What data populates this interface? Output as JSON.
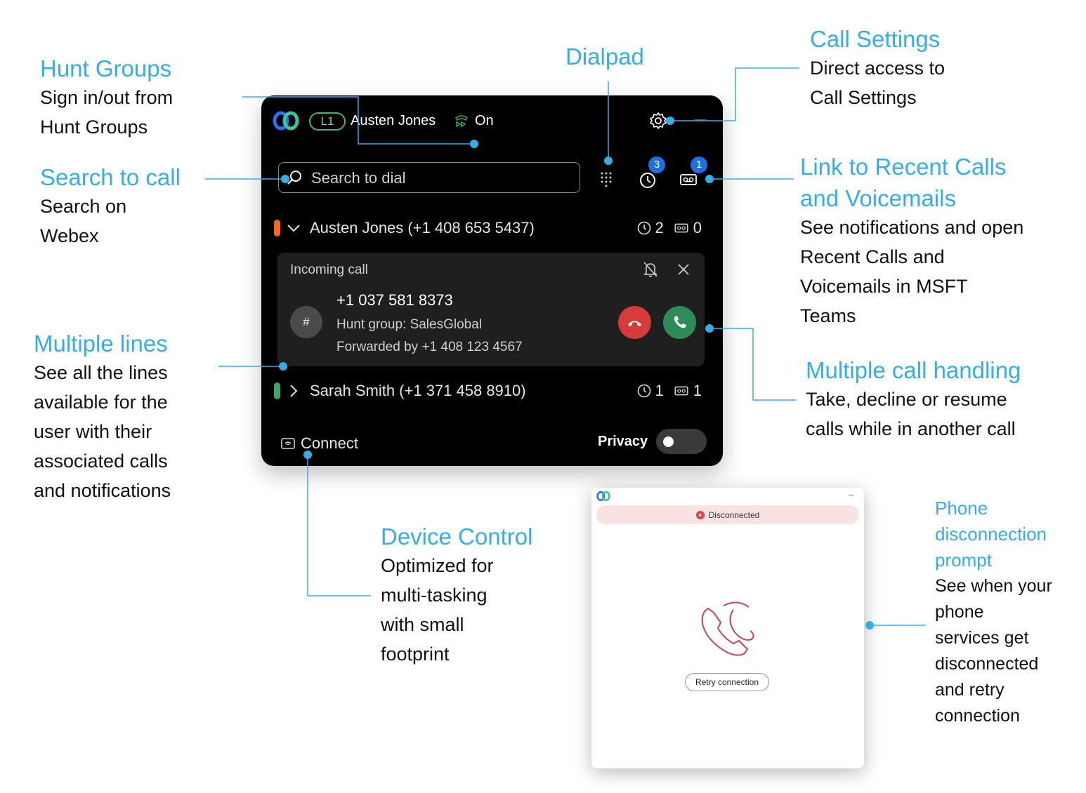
{
  "annotations": {
    "hunt_groups": {
      "title": "Hunt Groups",
      "body": "Sign in/out from\nHunt Groups"
    },
    "search_to_call": {
      "title": "Search to call",
      "body": "Search on\nWebex"
    },
    "multiple_lines": {
      "title": "Multiple lines",
      "body": "See all the lines\navailable for the\nuser with their\nassociated calls\nand notifications"
    },
    "dialpad": {
      "title": "Dialpad"
    },
    "call_settings": {
      "title": "Call Settings",
      "body": "Direct access to\nCall Settings"
    },
    "recent_calls": {
      "title_line1": "Link to Recent Calls",
      "title_line2": "and Voicemails",
      "body": "See notifications and open\nRecent Calls and\nVoicemails in MSFT\nTeams"
    },
    "multiple_call_handling": {
      "title": "Multiple call handling",
      "body": "Take, decline or resume\ncalls while in another call"
    },
    "device_control": {
      "title": "Device Control",
      "body": "Optimized for\nmulti-tasking\nwith small\nfootprint"
    },
    "phone_disconnection": {
      "title": "Phone\ndisconnection\nprompt",
      "body": "See when your\nphone\nservices get\ndisconnected\nand retry\nconnection"
    }
  },
  "widget": {
    "line_badge": "L1",
    "user_name": "Austen Jones",
    "hunt_status": "On",
    "search": {
      "placeholder": "Search to dial"
    },
    "recent_badge": "3",
    "voicemail_badge": "1",
    "lines": [
      {
        "label": "Austen Jones (+1 408 653 5437)",
        "calls": "2",
        "voicemails": "0",
        "color": "#f26b21",
        "expanded": true
      },
      {
        "label": "Sarah Smith (+1 371 458 8910)",
        "calls": "1",
        "voicemails": "1",
        "color": "#3aa86b",
        "expanded": false
      }
    ],
    "incoming_call": {
      "title": "Incoming call",
      "avatar": "#",
      "number": "+1 037 581 8373",
      "hunt_group": "Hunt group: SalesGlobal",
      "forwarded": "Forwarded by +1 408 123 4567"
    },
    "connect_label": "Connect",
    "privacy_label": "Privacy",
    "privacy_on": false
  },
  "disconnected_window": {
    "banner": "Disconnected",
    "retry_label": "Retry connection"
  },
  "colors": {
    "accent": "#33aee8",
    "decline": "#d63a3a",
    "answer": "#2e8b57",
    "badge": "#1e6fe0"
  }
}
